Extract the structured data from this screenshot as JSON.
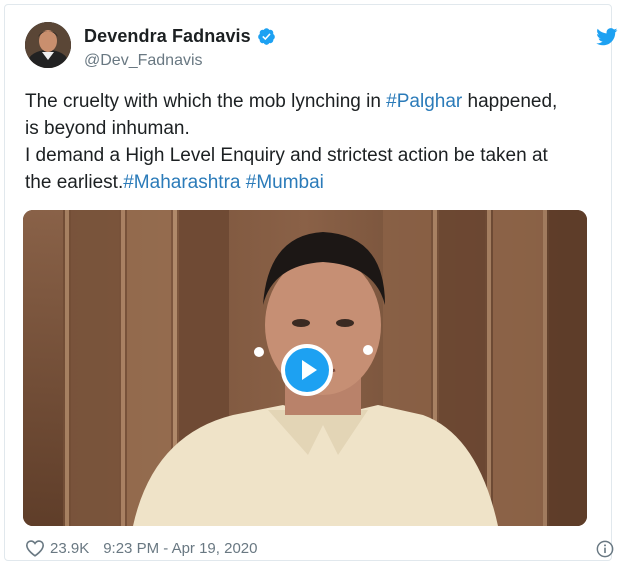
{
  "tweet": {
    "author": {
      "display_name": "Devendra Fadnavis",
      "handle": "@Dev_Fadnavis",
      "verified": true
    },
    "text_parts": {
      "l1_a": "The cruelty with which the mob lynching in ",
      "l1_tag": "#Palghar",
      "l1_b": " happened,",
      "l2": "is beyond inhuman.",
      "l3": "I demand a High Level Enquiry and strictest action be taken at",
      "l4_a": "the earliest.",
      "l4_tag1": "#Maharashtra",
      "l4_sp": " ",
      "l4_tag2": "#Mumbai"
    },
    "footer": {
      "likes": "23.9K",
      "timestamp": "9:23 PM - Apr 19, 2020"
    },
    "icons": {
      "brand": "twitter-bird-icon",
      "verified": "verified-badge-icon",
      "like": "heart-icon",
      "info": "info-icon",
      "play": "play-icon"
    },
    "colors": {
      "link": "#2b7bb9",
      "accent": "#1da1f2",
      "muted": "#697882"
    }
  }
}
